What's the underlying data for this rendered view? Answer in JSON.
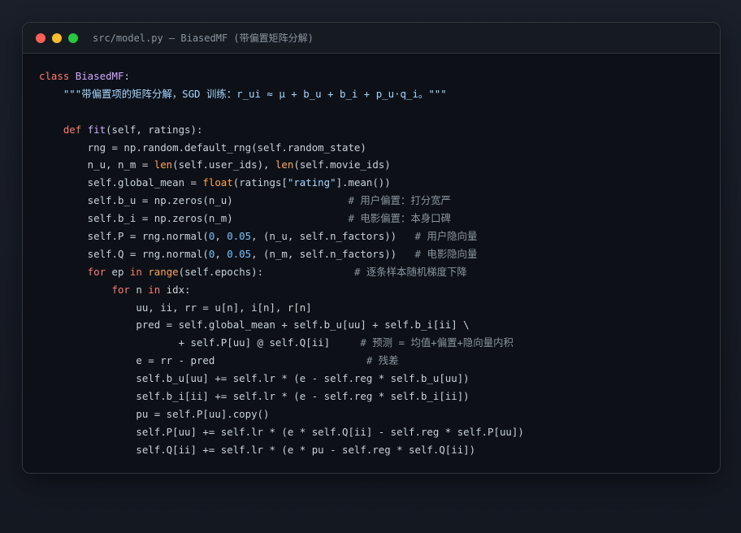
{
  "window": {
    "title": "src/model.py — BiasedMF (带偏置矩阵分解)"
  },
  "code_lines": [
    [
      {
        "t": "kw",
        "v": "class "
      },
      {
        "t": "cls",
        "v": "BiasedMF"
      },
      {
        "t": "tx",
        "v": ":"
      }
    ],
    [
      {
        "t": "str",
        "v": "    \"\"\"带偏置项的矩阵分解，SGD 训练：r_ui ≈ μ + b_u + b_i + p_u·q_i。\"\"\""
      }
    ],
    [],
    [
      {
        "t": "kw",
        "v": "    def "
      },
      {
        "t": "fn",
        "v": "fit"
      },
      {
        "t": "tx",
        "v": "(self, ratings):"
      }
    ],
    [
      {
        "t": "tx",
        "v": "        rng = np.random.default_rng(self.random_state)"
      }
    ],
    [
      {
        "t": "tx",
        "v": "        n_u, n_m = "
      },
      {
        "t": "bi",
        "v": "len"
      },
      {
        "t": "tx",
        "v": "(self.user_ids), "
      },
      {
        "t": "bi",
        "v": "len"
      },
      {
        "t": "tx",
        "v": "(self.movie_ids)"
      }
    ],
    [
      {
        "t": "tx",
        "v": "        self.global_mean = "
      },
      {
        "t": "bi",
        "v": "float"
      },
      {
        "t": "tx",
        "v": "(ratings["
      },
      {
        "t": "str",
        "v": "\"rating\""
      },
      {
        "t": "tx",
        "v": "].mean())"
      }
    ],
    [
      {
        "t": "tx",
        "v": "        self.b_u = np.zeros(n_u)                   "
      },
      {
        "t": "cm",
        "v": "# 用户偏置：打分宽严"
      }
    ],
    [
      {
        "t": "tx",
        "v": "        self.b_i = np.zeros(n_m)                   "
      },
      {
        "t": "cm",
        "v": "# 电影偏置：本身口碑"
      }
    ],
    [
      {
        "t": "tx",
        "v": "        self.P = rng.normal("
      },
      {
        "t": "num",
        "v": "0"
      },
      {
        "t": "tx",
        "v": ", "
      },
      {
        "t": "num",
        "v": "0.05"
      },
      {
        "t": "tx",
        "v": ", (n_u, self.n_factors))   "
      },
      {
        "t": "cm",
        "v": "# 用户隐向量"
      }
    ],
    [
      {
        "t": "tx",
        "v": "        self.Q = rng.normal("
      },
      {
        "t": "num",
        "v": "0"
      },
      {
        "t": "tx",
        "v": ", "
      },
      {
        "t": "num",
        "v": "0.05"
      },
      {
        "t": "tx",
        "v": ", (n_m, self.n_factors))   "
      },
      {
        "t": "cm",
        "v": "# 电影隐向量"
      }
    ],
    [
      {
        "t": "kw",
        "v": "        for "
      },
      {
        "t": "tx",
        "v": "ep "
      },
      {
        "t": "kw",
        "v": "in "
      },
      {
        "t": "bi",
        "v": "range"
      },
      {
        "t": "tx",
        "v": "(self.epochs):               "
      },
      {
        "t": "cm",
        "v": "# 逐条样本随机梯度下降"
      }
    ],
    [
      {
        "t": "kw",
        "v": "            for "
      },
      {
        "t": "tx",
        "v": "n "
      },
      {
        "t": "kw",
        "v": "in "
      },
      {
        "t": "tx",
        "v": "idx:"
      }
    ],
    [
      {
        "t": "tx",
        "v": "                uu, ii, rr = u[n], i[n], r[n]"
      }
    ],
    [
      {
        "t": "tx",
        "v": "                pred = self.global_mean + self.b_u[uu] + self.b_i[ii] \\"
      }
    ],
    [
      {
        "t": "tx",
        "v": "                       + self.P[uu] @ self.Q[ii]     "
      },
      {
        "t": "cm",
        "v": "# 预测 = 均值+偏置+隐向量内积"
      }
    ],
    [
      {
        "t": "tx",
        "v": "                e = rr - pred                         "
      },
      {
        "t": "cm",
        "v": "# 残差"
      }
    ],
    [
      {
        "t": "tx",
        "v": "                self.b_u[uu] += self.lr * (e - self.reg * self.b_u[uu])"
      }
    ],
    [
      {
        "t": "tx",
        "v": "                self.b_i[ii] += self.lr * (e - self.reg * self.b_i[ii])"
      }
    ],
    [
      {
        "t": "tx",
        "v": "                pu = self.P[uu].copy()"
      }
    ],
    [
      {
        "t": "tx",
        "v": "                self.P[uu] += self.lr * (e * self.Q[ii] - self.reg * self.P[uu])"
      }
    ],
    [
      {
        "t": "tx",
        "v": "                self.Q[ii] += self.lr * (e * pu - self.reg * self.Q[ii])"
      }
    ]
  ]
}
